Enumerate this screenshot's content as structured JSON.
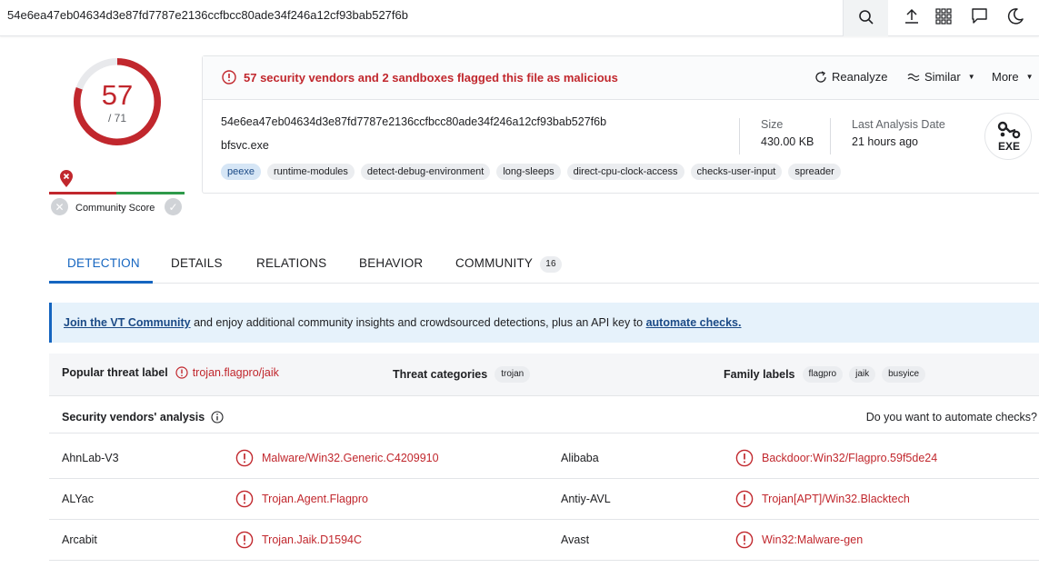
{
  "topbar": {
    "hash": "54e6ea47eb04634d3e87fd7787e2136ccfbcc80ade34f246a12cf93bab527f6b",
    "icons": [
      "search-icon",
      "upload-icon",
      "grid-icon",
      "chat-icon",
      "moon-icon"
    ]
  },
  "score": {
    "detections": "57",
    "total": "/ 71",
    "ratio": 0.8028,
    "community_label": "Community Score"
  },
  "summary": {
    "alert": "57 security vendors and 2 sandboxes flagged this file as malicious",
    "actions": {
      "reanalyze": "Reanalyze",
      "similar": "Similar",
      "more": "More"
    },
    "hash": "54e6ea47eb04634d3e87fd7787e2136ccfbcc80ade34f246a12cf93bab527f6b",
    "filename": "bfsvc.exe",
    "tags": [
      "peexe",
      "runtime-modules",
      "detect-debug-environment",
      "long-sleeps",
      "direct-cpu-clock-access",
      "checks-user-input",
      "spreader"
    ],
    "size_label": "Size",
    "size_value": "430.00 KB",
    "date_label": "Last Analysis Date",
    "date_value": "21 hours ago",
    "filetype": "EXE"
  },
  "tabs": {
    "detection": "DETECTION",
    "details": "DETAILS",
    "relations": "RELATIONS",
    "behavior": "BEHAVIOR",
    "community": "COMMUNITY",
    "community_count": "16"
  },
  "banner": {
    "link1": "Join the VT Community",
    "middle": " and enjoy additional community insights and crowdsourced detections, plus an API key to ",
    "link2": "automate checks."
  },
  "threat": {
    "popular_label": "Popular threat label",
    "popular_value": "trojan.flagpro/jaik",
    "categories_label": "Threat categories",
    "categories": [
      "trojan"
    ],
    "family_label": "Family labels",
    "families": [
      "flagpro",
      "jaik",
      "busyice"
    ]
  },
  "vendors": {
    "title": "Security vendors' analysis",
    "automate": "Do you want to automate checks?",
    "rows": [
      {
        "v1": "AhnLab-V3",
        "d1": "Malware/Win32.Generic.C4209910",
        "v2": "Alibaba",
        "d2": "Backdoor:Win32/Flagpro.59f5de24"
      },
      {
        "v1": "ALYac",
        "d1": "Trojan.Agent.Flagpro",
        "v2": "Antiy-AVL",
        "d2": "Trojan[APT]/Win32.Blacktech"
      },
      {
        "v1": "Arcabit",
        "d1": "Trojan.Jaik.D1594C",
        "v2": "Avast",
        "d2": "Win32:Malware-gen"
      }
    ]
  },
  "colors": {
    "malicious": "#c1272d",
    "accent": "#1565c0",
    "harmless": "#2e9a4a"
  }
}
